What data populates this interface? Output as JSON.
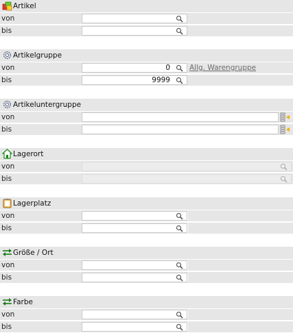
{
  "labels": {
    "von": "von",
    "bis": "bis"
  },
  "sections": [
    {
      "title": "Artikel",
      "icon": "artikel-icon"
    },
    {
      "title": "Artikelgruppe",
      "icon": "gear-icon",
      "von_value": "0",
      "bis_value": "9999",
      "link": "Allg. Warengruppe"
    },
    {
      "title": "Artikeluntergruppe",
      "icon": "gear-icon"
    },
    {
      "title": "Lagerort",
      "icon": "house-icon"
    },
    {
      "title": "Lagerplatz",
      "icon": "clipboard-icon"
    },
    {
      "title": "Größe / Ort",
      "icon": "arrows-icon"
    },
    {
      "title": "Farbe",
      "icon": "arrows-icon"
    }
  ],
  "colors": {
    "row_bg": "#e6e6e6",
    "link": "#6a6a6a"
  }
}
